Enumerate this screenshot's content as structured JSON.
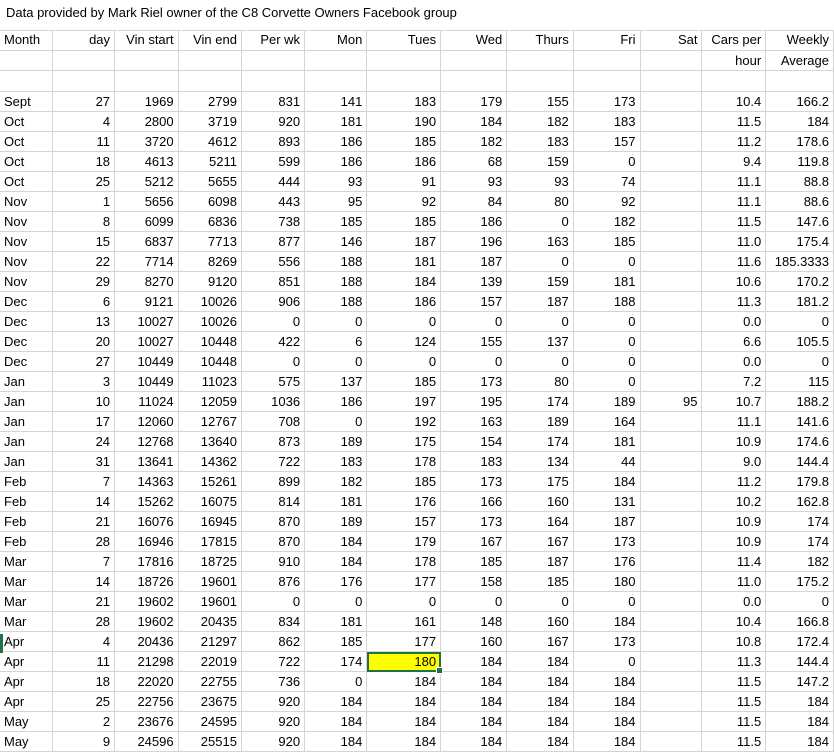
{
  "title": "Data provided by Mark Riel owner of the C8 Corvette Owners Facebook group",
  "headers": [
    "Month",
    "day",
    "Vin start",
    "Vin end",
    "Per wk",
    "Mon",
    "Tues",
    "Wed",
    "Thurs",
    "Fri",
    "Sat",
    "Cars per",
    "Weekly"
  ],
  "headers2": [
    "",
    "",
    "",
    "",
    "",
    "",
    "",
    "",
    "",
    "",
    "",
    "hour",
    "Average"
  ],
  "rows": [
    [
      "Sept",
      "27",
      "1969",
      "2799",
      "831",
      "141",
      "183",
      "179",
      "155",
      "173",
      "",
      "10.4",
      "166.2"
    ],
    [
      "Oct",
      "4",
      "2800",
      "3719",
      "920",
      "181",
      "190",
      "184",
      "182",
      "183",
      "",
      "11.5",
      "184"
    ],
    [
      "Oct",
      "11",
      "3720",
      "4612",
      "893",
      "186",
      "185",
      "182",
      "183",
      "157",
      "",
      "11.2",
      "178.6"
    ],
    [
      "Oct",
      "18",
      "4613",
      "5211",
      "599",
      "186",
      "186",
      "68",
      "159",
      "0",
      "",
      "9.4",
      "119.8"
    ],
    [
      "Oct",
      "25",
      "5212",
      "5655",
      "444",
      "93",
      "91",
      "93",
      "93",
      "74",
      "",
      "11.1",
      "88.8"
    ],
    [
      "Nov",
      "1",
      "5656",
      "6098",
      "443",
      "95",
      "92",
      "84",
      "80",
      "92",
      "",
      "11.1",
      "88.6"
    ],
    [
      "Nov",
      "8",
      "6099",
      "6836",
      "738",
      "185",
      "185",
      "186",
      "0",
      "182",
      "",
      "11.5",
      "147.6"
    ],
    [
      "Nov",
      "15",
      "6837",
      "7713",
      "877",
      "146",
      "187",
      "196",
      "163",
      "185",
      "",
      "11.0",
      "175.4"
    ],
    [
      "Nov",
      "22",
      "7714",
      "8269",
      "556",
      "188",
      "181",
      "187",
      "0",
      "0",
      "",
      "11.6",
      "185.3333"
    ],
    [
      "Nov",
      "29",
      "8270",
      "9120",
      "851",
      "188",
      "184",
      "139",
      "159",
      "181",
      "",
      "10.6",
      "170.2"
    ],
    [
      "Dec",
      "6",
      "9121",
      "10026",
      "906",
      "188",
      "186",
      "157",
      "187",
      "188",
      "",
      "11.3",
      "181.2"
    ],
    [
      "Dec",
      "13",
      "10027",
      "10026",
      "0",
      "0",
      "0",
      "0",
      "0",
      "0",
      "",
      "0.0",
      "0"
    ],
    [
      "Dec",
      "20",
      "10027",
      "10448",
      "422",
      "6",
      "124",
      "155",
      "137",
      "0",
      "",
      "6.6",
      "105.5"
    ],
    [
      "Dec",
      "27",
      "10449",
      "10448",
      "0",
      "0",
      "0",
      "0",
      "0",
      "0",
      "",
      "0.0",
      "0"
    ],
    [
      "Jan",
      "3",
      "10449",
      "11023",
      "575",
      "137",
      "185",
      "173",
      "80",
      "0",
      "",
      "7.2",
      "115"
    ],
    [
      "Jan",
      "10",
      "11024",
      "12059",
      "1036",
      "186",
      "197",
      "195",
      "174",
      "189",
      "95",
      "10.7",
      "188.2"
    ],
    [
      "Jan",
      "17",
      "12060",
      "12767",
      "708",
      "0",
      "192",
      "163",
      "189",
      "164",
      "",
      "11.1",
      "141.6"
    ],
    [
      "Jan",
      "24",
      "12768",
      "13640",
      "873",
      "189",
      "175",
      "154",
      "174",
      "181",
      "",
      "10.9",
      "174.6"
    ],
    [
      "Jan",
      "31",
      "13641",
      "14362",
      "722",
      "183",
      "178",
      "183",
      "134",
      "44",
      "",
      "9.0",
      "144.4"
    ],
    [
      "Feb",
      "7",
      "14363",
      "15261",
      "899",
      "182",
      "185",
      "173",
      "175",
      "184",
      "",
      "11.2",
      "179.8"
    ],
    [
      "Feb",
      "14",
      "15262",
      "16075",
      "814",
      "181",
      "176",
      "166",
      "160",
      "131",
      "",
      "10.2",
      "162.8"
    ],
    [
      "Feb",
      "21",
      "16076",
      "16945",
      "870",
      "189",
      "157",
      "173",
      "164",
      "187",
      "",
      "10.9",
      "174"
    ],
    [
      "Feb",
      "28",
      "16946",
      "17815",
      "870",
      "184",
      "179",
      "167",
      "167",
      "173",
      "",
      "10.9",
      "174"
    ],
    [
      "Mar",
      "7",
      "17816",
      "18725",
      "910",
      "184",
      "178",
      "185",
      "187",
      "176",
      "",
      "11.4",
      "182"
    ],
    [
      "Mar",
      "14",
      "18726",
      "19601",
      "876",
      "176",
      "177",
      "158",
      "185",
      "180",
      "",
      "11.0",
      "175.2"
    ],
    [
      "Mar",
      "21",
      "19602",
      "19601",
      "0",
      "0",
      "0",
      "0",
      "0",
      "0",
      "",
      "0.0",
      "0"
    ],
    [
      "Mar",
      "28",
      "19602",
      "20435",
      "834",
      "181",
      "161",
      "148",
      "160",
      "184",
      "",
      "10.4",
      "166.8"
    ],
    [
      "Apr",
      "4",
      "20436",
      "21297",
      "862",
      "185",
      "177",
      "160",
      "167",
      "173",
      "",
      "10.8",
      "172.4"
    ],
    [
      "Apr",
      "11",
      "21298",
      "22019",
      "722",
      "174",
      "180",
      "184",
      "184",
      "0",
      "",
      "11.3",
      "144.4"
    ],
    [
      "Apr",
      "18",
      "22020",
      "22755",
      "736",
      "0",
      "184",
      "184",
      "184",
      "184",
      "",
      "11.5",
      "147.2"
    ],
    [
      "Apr",
      "25",
      "22756",
      "23675",
      "920",
      "184",
      "184",
      "184",
      "184",
      "184",
      "",
      "11.5",
      "184"
    ],
    [
      "May",
      "2",
      "23676",
      "24595",
      "920",
      "184",
      "184",
      "184",
      "184",
      "184",
      "",
      "11.5",
      "184"
    ],
    [
      "May",
      "9",
      "24596",
      "25515",
      "920",
      "184",
      "184",
      "184",
      "184",
      "184",
      "",
      "11.5",
      "184"
    ]
  ],
  "highlight": {
    "row": 28,
    "col": 6,
    "color": "#ffff00"
  },
  "colors": {
    "gridline": "#d4d4d4",
    "selection": "#217346"
  }
}
